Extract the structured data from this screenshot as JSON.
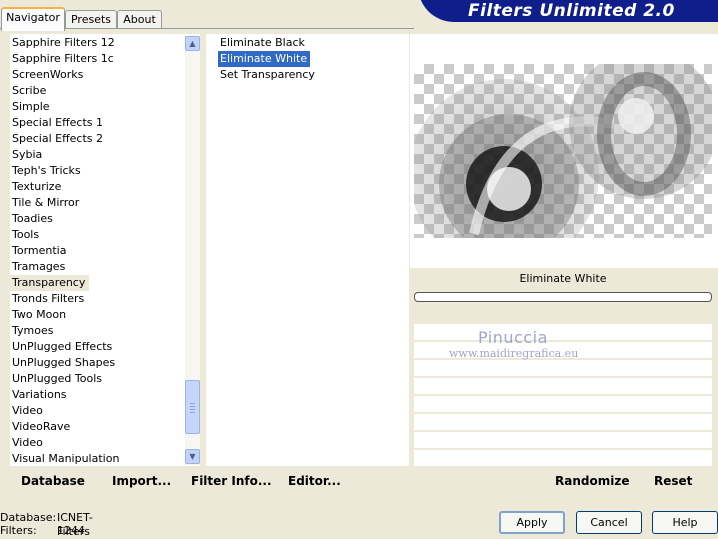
{
  "tabs": [
    {
      "label": "Navigator"
    },
    {
      "label": "Presets"
    },
    {
      "label": "About"
    }
  ],
  "banner": {
    "title": "Filters Unlimited 2.0"
  },
  "categories": [
    "Sapphire Filters 12",
    "Sapphire Filters 1c",
    "ScreenWorks",
    "Scribe",
    "Simple",
    "Special Effects 1",
    "Special Effects 2",
    "Sybia",
    "Teph's Tricks",
    "Texturize",
    "Tile & Mirror",
    "Toadies",
    "Tools",
    "Tormentia",
    "Tramages",
    "Transparency",
    "Tronds Filters",
    "Two Moon",
    "Tymoes",
    "UnPlugged Effects",
    "UnPlugged Shapes",
    "UnPlugged Tools",
    "Variations",
    "Video",
    "VideoRave",
    "Video",
    "Visual Manipulation"
  ],
  "selected_category": "Transparency",
  "filters": [
    "Eliminate Black",
    "Eliminate White",
    "Set Transparency"
  ],
  "selected_filter": "Eliminate White",
  "left_buttons": {
    "database": "Database",
    "import": "Import...",
    "filter_info": "Filter Info...",
    "editor": "Editor..."
  },
  "preview": {
    "filter_name": "Eliminate White"
  },
  "watermark": {
    "name": "Pinuccia",
    "url": "www.maidiregrafica.eu"
  },
  "right_buttons": {
    "randomize": "Randomize",
    "reset": "Reset"
  },
  "status": {
    "database_label": "Database:",
    "database_value": "ICNET-Filters",
    "filters_label": "Filters:",
    "filters_value": "1244"
  },
  "dialog_buttons": {
    "apply": "Apply",
    "cancel": "Cancel",
    "help": "Help"
  },
  "colors": {
    "accent": "#316ac5",
    "banner": "#0f1e8a",
    "tab_highlight": "#f6b33f"
  },
  "icons": {
    "scroll_up": "chevron-up-icon",
    "scroll_down": "chevron-down-icon"
  }
}
